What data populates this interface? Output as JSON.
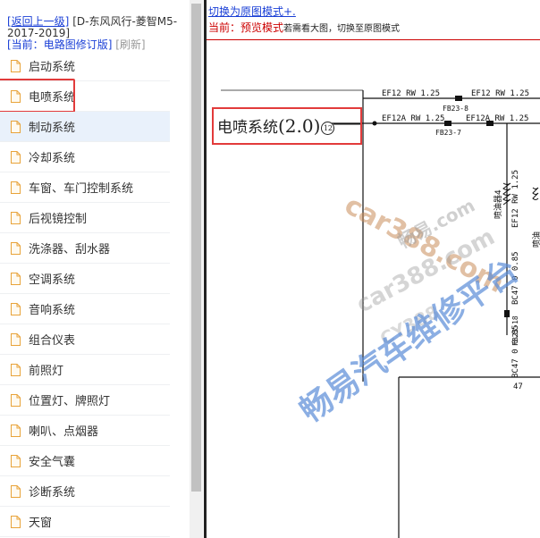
{
  "nav": {
    "back_link": "[返回上一级]",
    "vehicle": "[D-东风风行-菱智M5-2017-2019]",
    "current_prefix": "[当前：",
    "current_value": "电路图修订版]",
    "refresh": "[刷新]"
  },
  "tree": {
    "items": [
      {
        "label": "启动系统"
      },
      {
        "label": "电喷系统"
      },
      {
        "label": "制动系统"
      },
      {
        "label": "冷却系统"
      },
      {
        "label": "车窗、车门控制系统"
      },
      {
        "label": "后视镜控制"
      },
      {
        "label": "洗涤器、刮水器"
      },
      {
        "label": "空调系统"
      },
      {
        "label": "音响系统"
      },
      {
        "label": "组合仪表"
      },
      {
        "label": "前照灯"
      },
      {
        "label": "位置灯、牌照灯"
      },
      {
        "label": "喇叭、点烟器"
      },
      {
        "label": "安全气囊"
      },
      {
        "label": "诊断系统"
      },
      {
        "label": "天窗"
      }
    ]
  },
  "viewer": {
    "switch_link": "切换为原图模式+.",
    "status_label": "当前：",
    "status_mode": "预览模式",
    "status_hint": "若需看大图，切换至原图模式"
  },
  "diagram": {
    "title_text": "电喷系统",
    "title_version": "(2.0)",
    "title_circled": "12",
    "labels": {
      "wire_top_left": "EF12 RW 1.25",
      "wire_top_right": "EF12 RW 1.25",
      "fuse_fb23_8": "FB23-8",
      "wire_mid_left": "EF12A RW 1.25",
      "wire_mid_right": "EF12A RW 1.25",
      "fuse_fb23_7": "FB23-7",
      "vert_ef12": "EF12 RW 1.25",
      "vert_fuse": "喷油器4",
      "vert_bc47_1": "BC47 0 0.85",
      "vert_fb23_18": "FB23-18",
      "vert_bc47_2": "BC47 0 0.85",
      "pin_47": "47",
      "side_text": "喷油"
    }
  },
  "watermarks": {
    "w1": "car388.com",
    "w2": "畅易.com",
    "w3": "car388.com",
    "w4": "CY388",
    "w5": "畅易汽车维修平台"
  },
  "colors": {
    "link_blue": "#1a3fd6",
    "status_red": "#cc0000",
    "highlight_red": "#e23b3b",
    "selected_bg": "#e9f1fb",
    "doc_icon": "#e8a33a"
  }
}
